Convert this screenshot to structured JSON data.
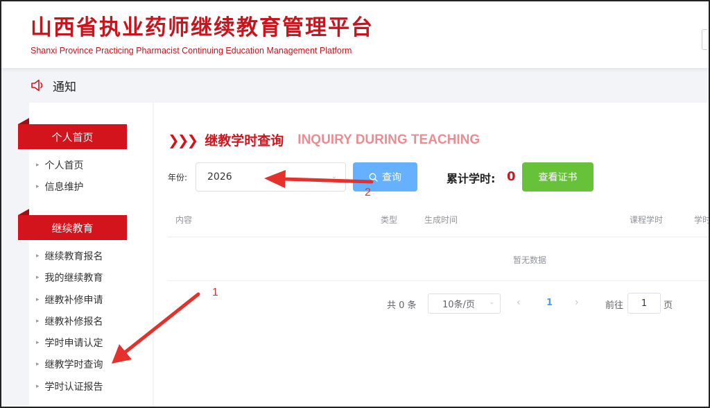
{
  "header": {
    "title": "山西省执业药师继续教育管理平台",
    "subtitle": "Shanxi Province Practicing Pharmacist Continuing Education Management Platform"
  },
  "notice": {
    "label": "通知",
    "icon": "speaker-icon"
  },
  "sidebar": {
    "sections": [
      {
        "title": "个人首页",
        "items": [
          "个人首页",
          "信息维护"
        ]
      },
      {
        "title": "继续教育",
        "items": [
          "继续教育报名",
          "我的继续教育",
          "继教补修申请",
          "继教补修报名",
          "学时申请认定",
          "继教学时查询",
          "学时认证报告"
        ]
      }
    ]
  },
  "main": {
    "title": "继教学时查询",
    "title_en": "INQUIRY DURING TEACHING",
    "year_label": "年份:",
    "year_value": "2026",
    "query_label": "查询",
    "total_label": "累计学时:",
    "total_value": "0",
    "cert_button": "查看证书",
    "table": {
      "columns": [
        "内容",
        "类型",
        "生成时间",
        "课程学时",
        "学时"
      ],
      "empty_text": "暂无数据"
    },
    "pagination": {
      "total": "共 0 条",
      "page_size": "10条/页",
      "current_page": "1",
      "goto_label": "前往",
      "goto_value": "1",
      "page_label": "页"
    }
  },
  "annotations": {
    "label_1": "1",
    "label_2": "2",
    "color": "#e4312b"
  },
  "colors": {
    "brand_red": "#c8151d",
    "primary_blue": "#66b1ff",
    "success_green": "#67c23a"
  }
}
